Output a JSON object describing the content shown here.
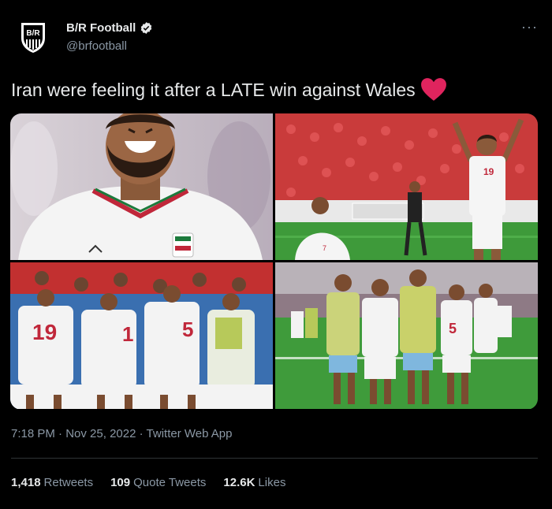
{
  "author": {
    "display_name": "B/R Football",
    "handle": "@brfootball",
    "avatar_text": "B/R",
    "verified": true
  },
  "more_icon": "more-horizontal-icon",
  "tweet": {
    "text": "Iran were feeling it after a LATE win against Wales",
    "emoji": "red-heart"
  },
  "media": {
    "images": [
      {
        "name": "smiling-player",
        "jersey": ""
      },
      {
        "name": "player-celebrating-arms-raised",
        "jersey": "19"
      },
      {
        "name": "team-huddle-celebration",
        "jersey": "19"
      },
      {
        "name": "players-celebrating-on-pitch",
        "jersey": "5"
      }
    ]
  },
  "meta": {
    "time": "7:18 PM",
    "date": "Nov 25, 2022",
    "source": "Twitter Web App",
    "separator": "·"
  },
  "stats": [
    {
      "value": "1,418",
      "label": "Retweets"
    },
    {
      "value": "109",
      "label": "Quote Tweets"
    },
    {
      "value": "12.6K",
      "label": "Likes"
    }
  ],
  "colors": {
    "background": "#000000",
    "text": "#e7e9ea",
    "secondary": "#8b98a5",
    "heart": "#e0245e"
  }
}
